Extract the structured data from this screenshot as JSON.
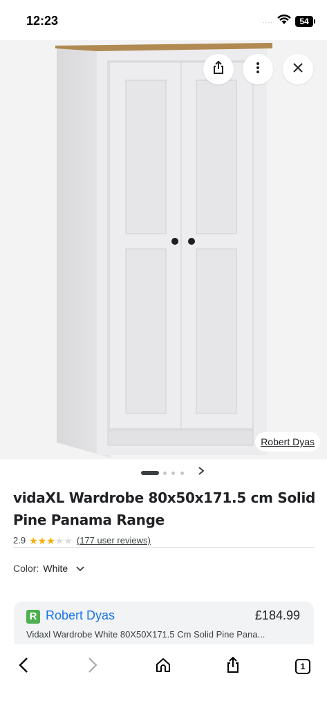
{
  "status_bar": {
    "time": "12:23",
    "signal": "....",
    "battery": "54",
    "icons": [
      "wifi-icon",
      "battery-icon"
    ]
  },
  "hero": {
    "merchant_chip": "Robert Dyas",
    "actions": [
      "share-icon",
      "more-vert-icon",
      "close-icon"
    ],
    "colors": {
      "background": "#f3f3f3",
      "wardrobe": "#e8e8ea",
      "top": "#b08a52",
      "handle": "#1f1f1f"
    }
  },
  "carousel": {
    "total": 4,
    "active": 1,
    "next_icon": "chevron-right-icon"
  },
  "product": {
    "title_line1": "vidaXL Wardrobe 80x50x171.5 cm Solid",
    "title_line2": "Pine Panama Range",
    "rating": "2.9",
    "stars_filled": 3,
    "stars_total": 5,
    "reviews": "(177 user reviews)",
    "color_label": "Color:",
    "color_value": "White"
  },
  "offer": {
    "logo": "R",
    "merchant": "Robert Dyas",
    "price": "£184.99",
    "description": "Vidaxl Wardrobe White 80X50X171.5 Cm Solid Pine Pana..."
  },
  "toolbar": {
    "tabs_count": "1",
    "icons": [
      "back-icon",
      "forward-icon",
      "home-icon",
      "share-icon",
      "tabs-icon"
    ]
  },
  "colors": {
    "link": "#1a73e8",
    "star": "#f9ab00",
    "logo": "#4caf50"
  }
}
